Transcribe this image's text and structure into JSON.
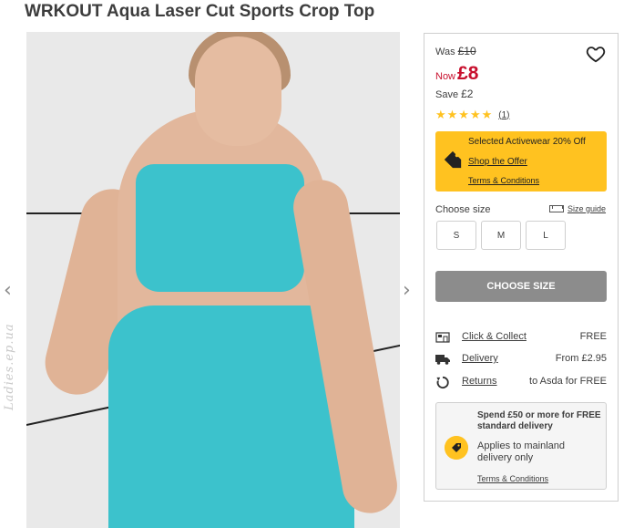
{
  "product": {
    "title": "WRKOUT Aqua Laser Cut Sports Crop Top",
    "image_watermark": "Ladies.ep.ua"
  },
  "gallery": {
    "prev_icon": "chevron-left-icon",
    "next_icon": "chevron-right-icon",
    "prev_glyph": "‹",
    "next_glyph": "›"
  },
  "pricing": {
    "was_label": "Was",
    "was_value": "£10",
    "now_label": "Now",
    "now_value": "£8",
    "save_label": "Save",
    "save_value": "£2",
    "now_color": "#c8102e"
  },
  "rating": {
    "stars": "★★★★★",
    "value": 5,
    "count": "(1)"
  },
  "offer": {
    "title": "Selected Activewear 20% Off",
    "link": "Shop the Offer",
    "terms": "Terms & Conditions",
    "icon": "price-tag-icon",
    "color": "#ffc220"
  },
  "size": {
    "label": "Choose size",
    "guide_label": "Size guide",
    "options": [
      "S",
      "M",
      "L"
    ],
    "button_label": "CHOOSE SIZE"
  },
  "delivery": [
    {
      "icon": "store-icon",
      "label": "Click & Collect",
      "value": "FREE"
    },
    {
      "icon": "truck-icon",
      "label": "Delivery",
      "value": "From £2.95"
    },
    {
      "icon": "return-icon",
      "label": "Returns",
      "value": "to Asda for FREE"
    }
  ],
  "promo": {
    "headline": "Spend £50 or more for FREE standard delivery",
    "body": "Applies to mainland delivery only",
    "terms": "Terms & Conditions",
    "icon": "tag-icon"
  }
}
